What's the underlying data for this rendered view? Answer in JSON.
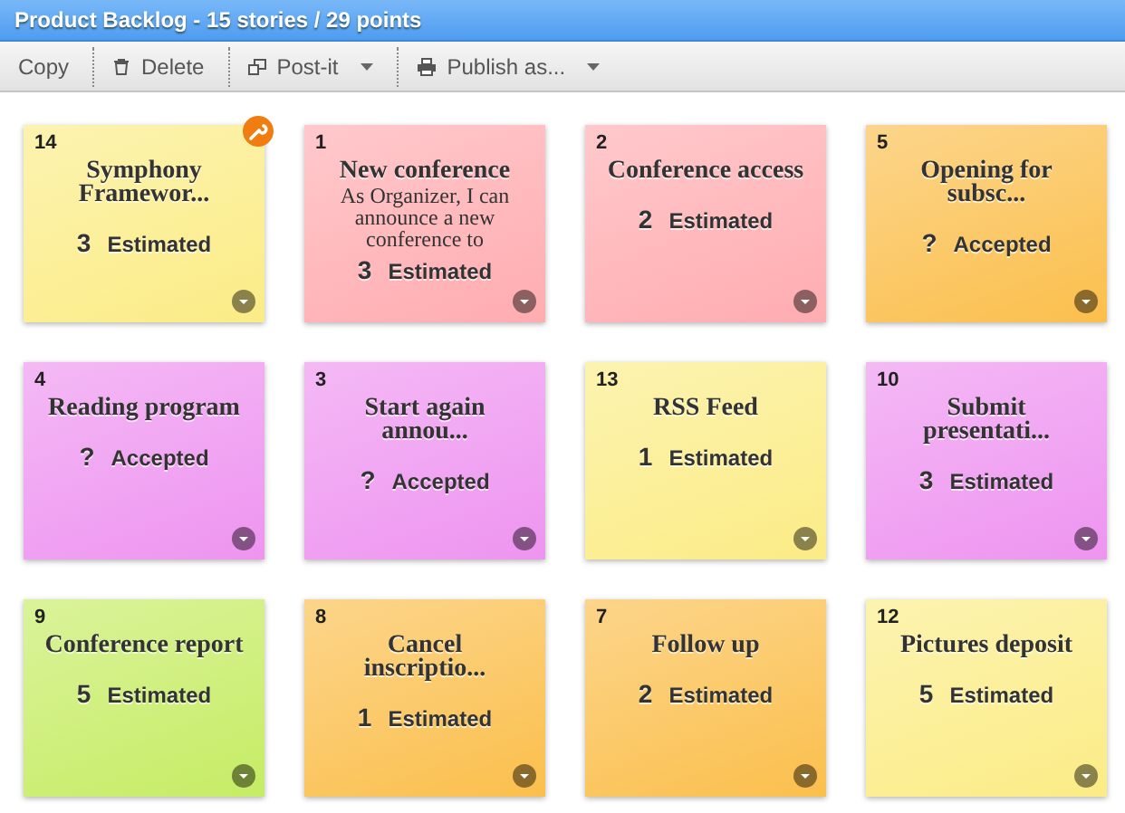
{
  "window": {
    "title": "Product Backlog - 15 stories / 29 points"
  },
  "toolbar": [
    {
      "label": "Copy",
      "kind": "button"
    },
    {
      "label": "Delete",
      "kind": "button"
    },
    {
      "label": "Post-it",
      "kind": "menu"
    },
    {
      "label": "Publish as...",
      "kind": "menu"
    }
  ],
  "cards": [
    {
      "number": "14",
      "title": "Symphony Framewor...",
      "points": "3",
      "status": "Estimated",
      "color": "#fbec86",
      "badge": true
    },
    {
      "number": "1",
      "title": "New conference",
      "description": "As Organizer, I can announce a new conference to",
      "points": "3",
      "status": "Estimated",
      "color": "#ffacb0",
      "badge": false
    },
    {
      "number": "2",
      "title": "Conference access",
      "points": "2",
      "status": "Estimated",
      "color": "#ffacb0",
      "badge": false
    },
    {
      "number": "5",
      "title": "Opening for subsc...",
      "points": "?",
      "status": "Accepted",
      "color": "#fbbf4c",
      "badge": false
    },
    {
      "number": "4",
      "title": "Reading program",
      "points": "?",
      "status": "Accepted",
      "color": "#ee94f0",
      "badge": false
    },
    {
      "number": "3",
      "title": "Start again annou...",
      "points": "?",
      "status": "Accepted",
      "color": "#ee94f0",
      "badge": false
    },
    {
      "number": "13",
      "title": "RSS Feed",
      "points": "1",
      "status": "Estimated",
      "color": "#fbec86",
      "badge": false
    },
    {
      "number": "10",
      "title": "Submit presentati...",
      "points": "3",
      "status": "Estimated",
      "color": "#ee94f0",
      "badge": false
    },
    {
      "number": "9",
      "title": "Conference report",
      "points": "5",
      "status": "Estimated",
      "color": "#c6ec64",
      "badge": false
    },
    {
      "number": "8",
      "title": "Cancel inscriptio...",
      "points": "1",
      "status": "Estimated",
      "color": "#fbbf4c",
      "badge": false
    },
    {
      "number": "7",
      "title": "Follow up",
      "points": "2",
      "status": "Estimated",
      "color": "#fbbf4c",
      "badge": false
    },
    {
      "number": "12",
      "title": "Pictures deposit",
      "points": "5",
      "status": "Estimated",
      "color": "#fbec86",
      "badge": false
    }
  ]
}
